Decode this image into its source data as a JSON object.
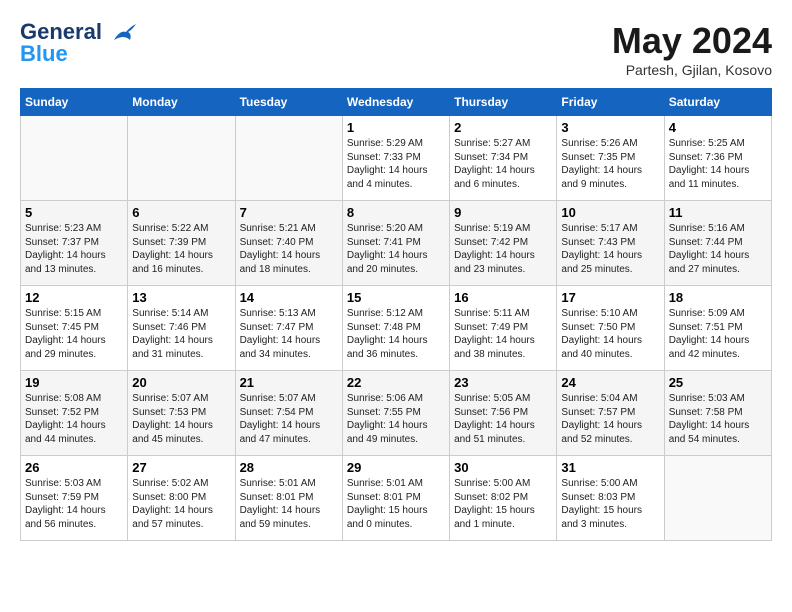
{
  "header": {
    "logo_line1": "General",
    "logo_line2": "Blue",
    "month": "May 2024",
    "location": "Partesh, Gjilan, Kosovo"
  },
  "weekdays": [
    "Sunday",
    "Monday",
    "Tuesday",
    "Wednesday",
    "Thursday",
    "Friday",
    "Saturday"
  ],
  "weeks": [
    [
      {
        "day": "",
        "content": ""
      },
      {
        "day": "",
        "content": ""
      },
      {
        "day": "",
        "content": ""
      },
      {
        "day": "1",
        "content": "Sunrise: 5:29 AM\nSunset: 7:33 PM\nDaylight: 14 hours\nand 4 minutes."
      },
      {
        "day": "2",
        "content": "Sunrise: 5:27 AM\nSunset: 7:34 PM\nDaylight: 14 hours\nand 6 minutes."
      },
      {
        "day": "3",
        "content": "Sunrise: 5:26 AM\nSunset: 7:35 PM\nDaylight: 14 hours\nand 9 minutes."
      },
      {
        "day": "4",
        "content": "Sunrise: 5:25 AM\nSunset: 7:36 PM\nDaylight: 14 hours\nand 11 minutes."
      }
    ],
    [
      {
        "day": "5",
        "content": "Sunrise: 5:23 AM\nSunset: 7:37 PM\nDaylight: 14 hours\nand 13 minutes."
      },
      {
        "day": "6",
        "content": "Sunrise: 5:22 AM\nSunset: 7:39 PM\nDaylight: 14 hours\nand 16 minutes."
      },
      {
        "day": "7",
        "content": "Sunrise: 5:21 AM\nSunset: 7:40 PM\nDaylight: 14 hours\nand 18 minutes."
      },
      {
        "day": "8",
        "content": "Sunrise: 5:20 AM\nSunset: 7:41 PM\nDaylight: 14 hours\nand 20 minutes."
      },
      {
        "day": "9",
        "content": "Sunrise: 5:19 AM\nSunset: 7:42 PM\nDaylight: 14 hours\nand 23 minutes."
      },
      {
        "day": "10",
        "content": "Sunrise: 5:17 AM\nSunset: 7:43 PM\nDaylight: 14 hours\nand 25 minutes."
      },
      {
        "day": "11",
        "content": "Sunrise: 5:16 AM\nSunset: 7:44 PM\nDaylight: 14 hours\nand 27 minutes."
      }
    ],
    [
      {
        "day": "12",
        "content": "Sunrise: 5:15 AM\nSunset: 7:45 PM\nDaylight: 14 hours\nand 29 minutes."
      },
      {
        "day": "13",
        "content": "Sunrise: 5:14 AM\nSunset: 7:46 PM\nDaylight: 14 hours\nand 31 minutes."
      },
      {
        "day": "14",
        "content": "Sunrise: 5:13 AM\nSunset: 7:47 PM\nDaylight: 14 hours\nand 34 minutes."
      },
      {
        "day": "15",
        "content": "Sunrise: 5:12 AM\nSunset: 7:48 PM\nDaylight: 14 hours\nand 36 minutes."
      },
      {
        "day": "16",
        "content": "Sunrise: 5:11 AM\nSunset: 7:49 PM\nDaylight: 14 hours\nand 38 minutes."
      },
      {
        "day": "17",
        "content": "Sunrise: 5:10 AM\nSunset: 7:50 PM\nDaylight: 14 hours\nand 40 minutes."
      },
      {
        "day": "18",
        "content": "Sunrise: 5:09 AM\nSunset: 7:51 PM\nDaylight: 14 hours\nand 42 minutes."
      }
    ],
    [
      {
        "day": "19",
        "content": "Sunrise: 5:08 AM\nSunset: 7:52 PM\nDaylight: 14 hours\nand 44 minutes."
      },
      {
        "day": "20",
        "content": "Sunrise: 5:07 AM\nSunset: 7:53 PM\nDaylight: 14 hours\nand 45 minutes."
      },
      {
        "day": "21",
        "content": "Sunrise: 5:07 AM\nSunset: 7:54 PM\nDaylight: 14 hours\nand 47 minutes."
      },
      {
        "day": "22",
        "content": "Sunrise: 5:06 AM\nSunset: 7:55 PM\nDaylight: 14 hours\nand 49 minutes."
      },
      {
        "day": "23",
        "content": "Sunrise: 5:05 AM\nSunset: 7:56 PM\nDaylight: 14 hours\nand 51 minutes."
      },
      {
        "day": "24",
        "content": "Sunrise: 5:04 AM\nSunset: 7:57 PM\nDaylight: 14 hours\nand 52 minutes."
      },
      {
        "day": "25",
        "content": "Sunrise: 5:03 AM\nSunset: 7:58 PM\nDaylight: 14 hours\nand 54 minutes."
      }
    ],
    [
      {
        "day": "26",
        "content": "Sunrise: 5:03 AM\nSunset: 7:59 PM\nDaylight: 14 hours\nand 56 minutes."
      },
      {
        "day": "27",
        "content": "Sunrise: 5:02 AM\nSunset: 8:00 PM\nDaylight: 14 hours\nand 57 minutes."
      },
      {
        "day": "28",
        "content": "Sunrise: 5:01 AM\nSunset: 8:01 PM\nDaylight: 14 hours\nand 59 minutes."
      },
      {
        "day": "29",
        "content": "Sunrise: 5:01 AM\nSunset: 8:01 PM\nDaylight: 15 hours\nand 0 minutes."
      },
      {
        "day": "30",
        "content": "Sunrise: 5:00 AM\nSunset: 8:02 PM\nDaylight: 15 hours\nand 1 minute."
      },
      {
        "day": "31",
        "content": "Sunrise: 5:00 AM\nSunset: 8:03 PM\nDaylight: 15 hours\nand 3 minutes."
      },
      {
        "day": "",
        "content": ""
      }
    ]
  ]
}
